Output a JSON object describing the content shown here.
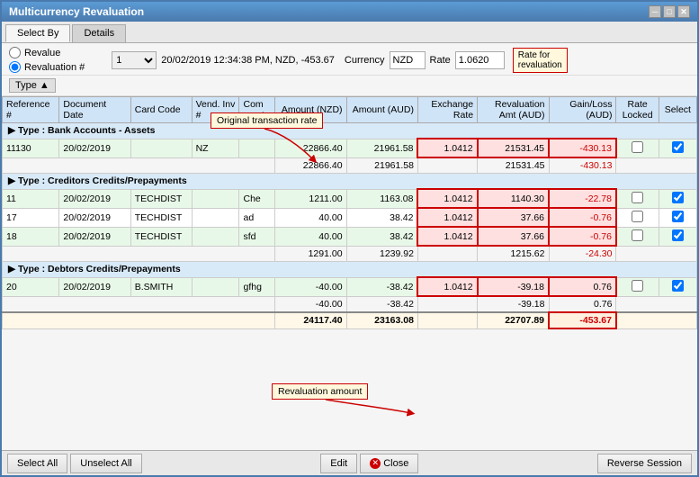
{
  "window": {
    "title": "Multicurrency Revaluation"
  },
  "tabs": [
    {
      "label": "Select By",
      "active": false
    },
    {
      "label": "Details",
      "active": false
    }
  ],
  "select_by": {
    "options": [
      {
        "label": "Revalue",
        "checked": false
      },
      {
        "label": "Revaluation #",
        "checked": true
      }
    ]
  },
  "revaluation": {
    "number": "1",
    "datetime": "20/02/2019 12:34:38 PM, NZD, -453.67",
    "currency_label": "Currency",
    "currency_value": "NZD",
    "rate_label": "Rate",
    "rate_value": "1.0620",
    "rate_callout": "Rate for\nrevaluation"
  },
  "type_button": {
    "label": "Type",
    "sort": "▲"
  },
  "columns": {
    "ref": "Reference #",
    "doc": "Document Date",
    "card": "Card Code",
    "vend": "Vend. Inv #",
    "com": "Com ment",
    "amtnzd": "Amount (NZD)",
    "amtaud": "Amount (AUD)",
    "exch": "Exchange Rate",
    "revamt": "Revaluation Amt (AUD)",
    "gain": "Gain/Loss (AUD)",
    "locked": "Rate Locked",
    "select": "Select"
  },
  "annotation_orig_rate": "Original transaction rate",
  "annotation_rev_amount": "Revaluation amount",
  "groups": [
    {
      "type": "group",
      "label": "Type : Bank Accounts - Assets",
      "rows": [
        {
          "ref": "11130",
          "doc": "20/02/2019",
          "card": "",
          "vend": "NZ",
          "com": "",
          "amtnzd": "22866.40",
          "amtaud": "21961.58",
          "exch": "1.0412",
          "revamt": "21531.45",
          "gain": "-430.13",
          "locked": false,
          "select": true,
          "style": "green"
        }
      ],
      "subtotal": {
        "amtnzd": "22866.40",
        "amtaud": "21961.58",
        "revamt": "21531.45",
        "gain": "-430.13"
      }
    },
    {
      "type": "group",
      "label": "Type : Creditors Credits/Prepayments",
      "rows": [
        {
          "ref": "11",
          "doc": "20/02/2019",
          "card": "TECHDIST",
          "vend": "",
          "com": "Che",
          "amtnzd": "1211.00",
          "amtaud": "1163.08",
          "exch": "1.0412",
          "revamt": "1140.30",
          "gain": "-22.78",
          "locked": false,
          "select": true,
          "style": "green"
        },
        {
          "ref": "17",
          "doc": "20/02/2019",
          "card": "TECHDIST",
          "vend": "",
          "com": "ad",
          "amtnzd": "40.00",
          "amtaud": "38.42",
          "exch": "1.0412",
          "revamt": "37.66",
          "gain": "-0.76",
          "locked": false,
          "select": true,
          "style": "white"
        },
        {
          "ref": "18",
          "doc": "20/02/2019",
          "card": "TECHDIST",
          "vend": "",
          "com": "sfd",
          "amtnzd": "40.00",
          "amtaud": "38.42",
          "exch": "1.0412",
          "revamt": "37.66",
          "gain": "-0.76",
          "locked": false,
          "select": true,
          "style": "green"
        }
      ],
      "subtotal": {
        "amtnzd": "1291.00",
        "amtaud": "1239.92",
        "revamt": "1215.62",
        "gain": "-24.30"
      }
    },
    {
      "type": "group",
      "label": "Type : Debtors Credits/Prepayments",
      "rows": [
        {
          "ref": "20",
          "doc": "20/02/2019",
          "card": "B.SMITH",
          "vend": "",
          "com": "gfhg",
          "amtnzd": "-40.00",
          "amtaud": "-38.42",
          "exch": "1.0412",
          "revamt": "-39.18",
          "gain": "0.76",
          "locked": false,
          "select": true,
          "style": "green"
        }
      ],
      "subtotal": {
        "amtnzd": "-40.00",
        "amtaud": "-38.42",
        "revamt": "-39.18",
        "gain": "0.76"
      }
    }
  ],
  "grand_total": {
    "amtnzd": "24117.40",
    "amtaud": "23163.08",
    "revamt": "22707.89",
    "gain": "-453.67"
  },
  "buttons": {
    "select_all": "Select All",
    "unselect_all": "Unselect All",
    "edit": "Edit",
    "close": "Close",
    "reverse_session": "Reverse Session"
  }
}
